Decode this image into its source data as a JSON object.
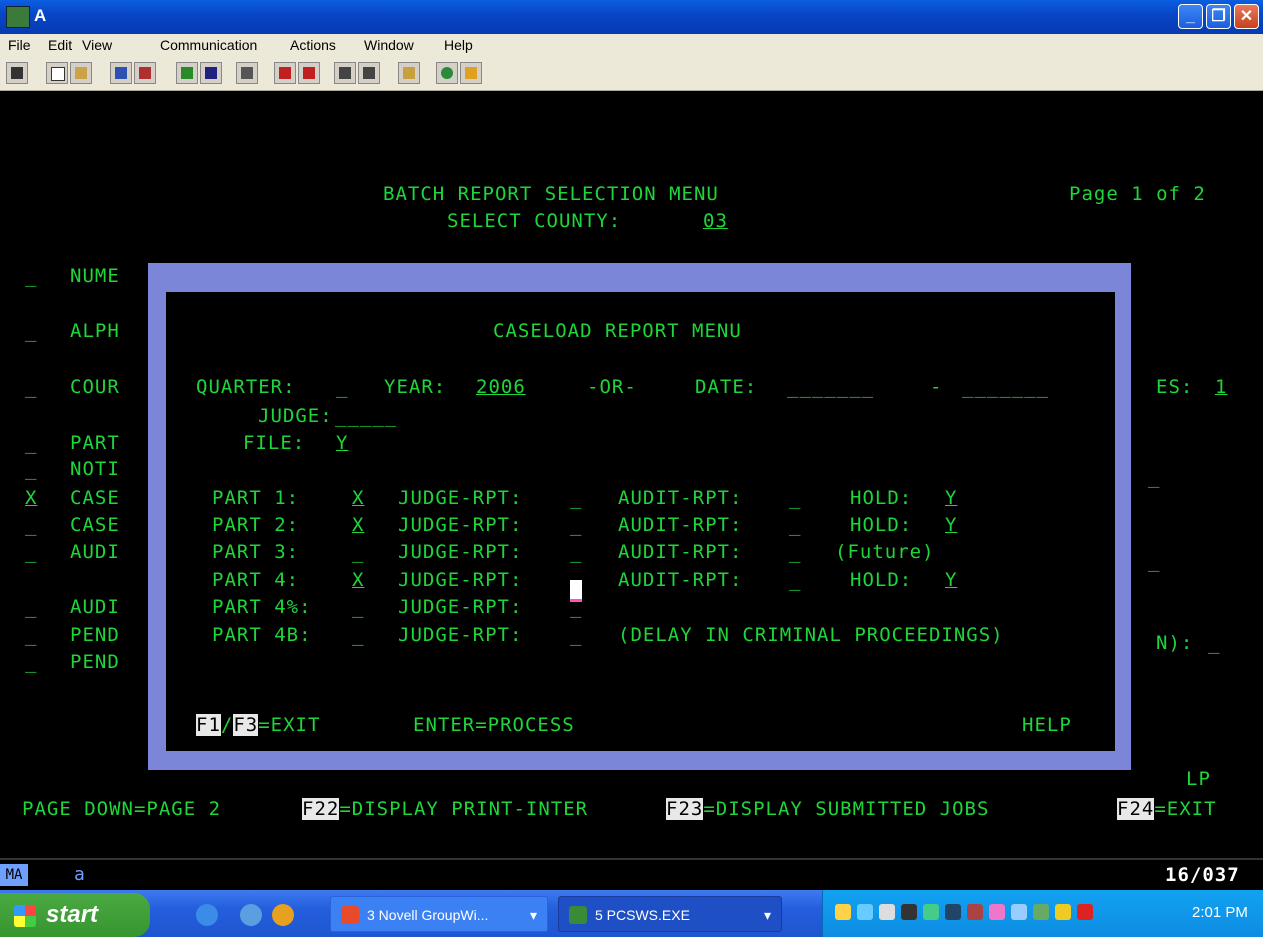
{
  "window": {
    "title": "A"
  },
  "menu": [
    "File",
    "Edit",
    "View",
    "Communication",
    "Actions",
    "Window",
    "Help"
  ],
  "screen": {
    "title": "BATCH REPORT SELECTION MENU",
    "page": "Page 1 of 2",
    "county_label": "SELECT COUNTY:",
    "county_value": "03",
    "bg_items": [
      {
        "sel": "_",
        "label": "NUME"
      },
      {
        "sel": "_",
        "label": "ALPH"
      },
      {
        "sel": "_",
        "label": "COUR"
      },
      {
        "sel": "_",
        "label": "PART"
      },
      {
        "sel": "_",
        "label": "NOTI"
      },
      {
        "sel": "X",
        "label": "CASE"
      },
      {
        "sel": "_",
        "label": "CASE"
      },
      {
        "sel": "_",
        "label": "AUDI"
      },
      {
        "sel": "_",
        "label": "AUDI"
      },
      {
        "sel": "_",
        "label": "PEND"
      },
      {
        "sel": "_",
        "label": "PEND"
      }
    ],
    "right_es_label": "ES:",
    "right_es_value": "1",
    "right_blank_1": "_",
    "right_blank_2": "_",
    "right_n_label": "N):",
    "right_n_value": "_",
    "lp": "LP",
    "bottom": {
      "pagedown": "PAGE DOWN=PAGE 2",
      "f22_key": "F22",
      "f22_text": "=DISPLAY PRINT-INTER",
      "f23_key": "F23",
      "f23_text": "=DISPLAY SUBMITTED JOBS",
      "f24_key": "F24",
      "f24_text": "=EXIT"
    },
    "status_left": "MA",
    "status_a": "a",
    "status_pos": "16/037"
  },
  "popup": {
    "title": "CASELOAD REPORT MENU",
    "quarter_label": "QUARTER:",
    "quarter_value": "_",
    "year_label": "YEAR:",
    "year_value": "2006",
    "or_label": "-OR-",
    "date_label": "DATE:",
    "date_from": "_______",
    "date_sep": "-",
    "date_to": "_______",
    "judge_label": "JUDGE:",
    "judge_value": "_____",
    "file_label": "FILE:",
    "file_value": "Y",
    "parts": [
      {
        "label": "PART 1:",
        "sel": "X",
        "judge_label": "JUDGE-RPT:",
        "judge": "_",
        "audit_label": "AUDIT-RPT:",
        "audit": "_",
        "hold_label": "HOLD:",
        "hold": "Y",
        "note": ""
      },
      {
        "label": "PART 2:",
        "sel": "X",
        "judge_label": "JUDGE-RPT:",
        "judge": "_",
        "audit_label": "AUDIT-RPT:",
        "audit": "_",
        "hold_label": "HOLD:",
        "hold": "Y",
        "note": ""
      },
      {
        "label": "PART 3:",
        "sel": "_",
        "judge_label": "JUDGE-RPT:",
        "judge": "_",
        "audit_label": "AUDIT-RPT:",
        "audit": "_",
        "hold_label": "",
        "hold": "",
        "note": "(Future)"
      },
      {
        "label": "PART 4:",
        "sel": "X",
        "judge_label": "JUDGE-RPT:",
        "judge": "",
        "audit_label": "AUDIT-RPT:",
        "audit": "_",
        "hold_label": "HOLD:",
        "hold": "Y",
        "note": ""
      },
      {
        "label": "PART 4%:",
        "sel": "_",
        "judge_label": "JUDGE-RPT:",
        "judge": "_",
        "audit_label": "",
        "audit": "",
        "hold_label": "",
        "hold": "",
        "note": ""
      },
      {
        "label": "PART 4B:",
        "sel": "_",
        "judge_label": "JUDGE-RPT:",
        "judge": "_",
        "audit_label": "",
        "audit": "",
        "hold_label": "",
        "hold": "",
        "note": "(DELAY IN CRIMINAL PROCEEDINGS)"
      }
    ],
    "f1_key": "F1",
    "slash": "/",
    "f3_key": "F3",
    "exit_text": "=EXIT",
    "enter_text": "ENTER=PROCESS",
    "help_text": "HELP"
  },
  "taskbar": {
    "start": "start",
    "task1": "3 Novell GroupWi...",
    "task2": "5 PCSWS.EXE",
    "clock": "2:01 PM"
  },
  "colors": {
    "terminal_text": "#1fd63a",
    "popup_frame": "#7b86d8",
    "titlebar": "#0846c8"
  }
}
